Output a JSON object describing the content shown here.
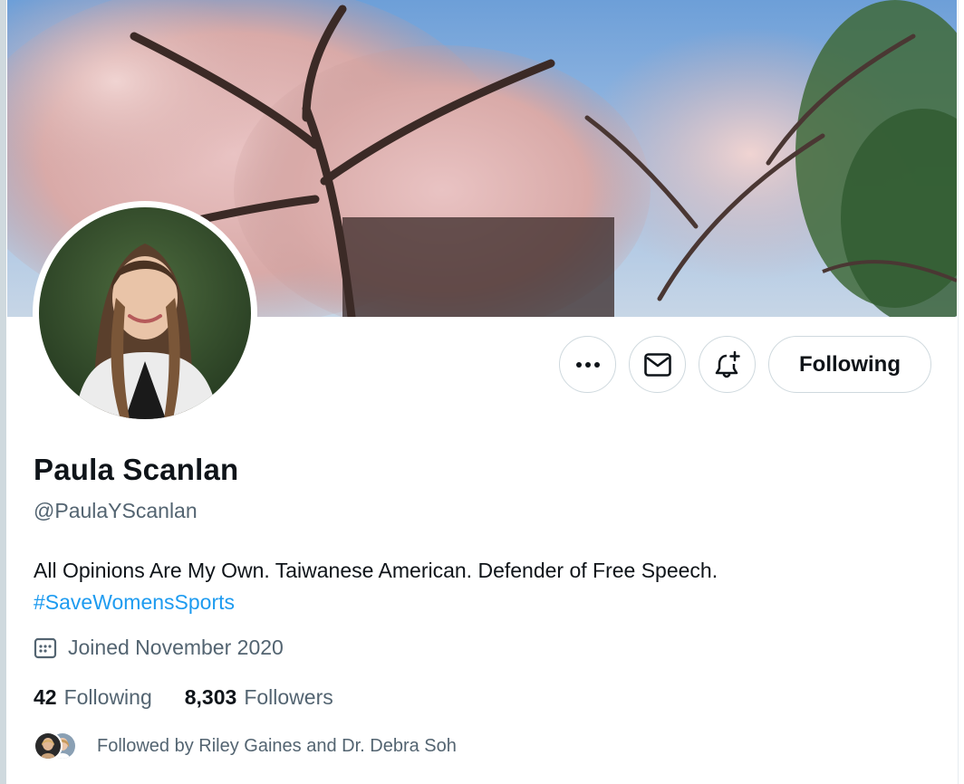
{
  "profile": {
    "display_name": "Paula Scanlan",
    "handle": "@PaulaYScanlan",
    "bio_text": "All Opinions Are My Own. Taiwanese American. Defender of Free Speech.",
    "bio_hashtag": "#SaveWomensSports",
    "joined": "Joined November 2020"
  },
  "actions": {
    "more_icon": "more-horizontal-icon",
    "message_icon": "envelope-icon",
    "notify_icon": "bell-plus-icon",
    "following_label": "Following"
  },
  "stats": {
    "following_count": "42",
    "following_label": "Following",
    "followers_count": "8,303",
    "followers_label": "Followers"
  },
  "followed_by": {
    "text": "Followed by Riley Gaines and Dr. Debra Soh"
  },
  "colors": {
    "accent": "#1d9bf0",
    "secondary_text": "#536471",
    "primary_text": "#0f1419",
    "border": "#cfd9de"
  }
}
